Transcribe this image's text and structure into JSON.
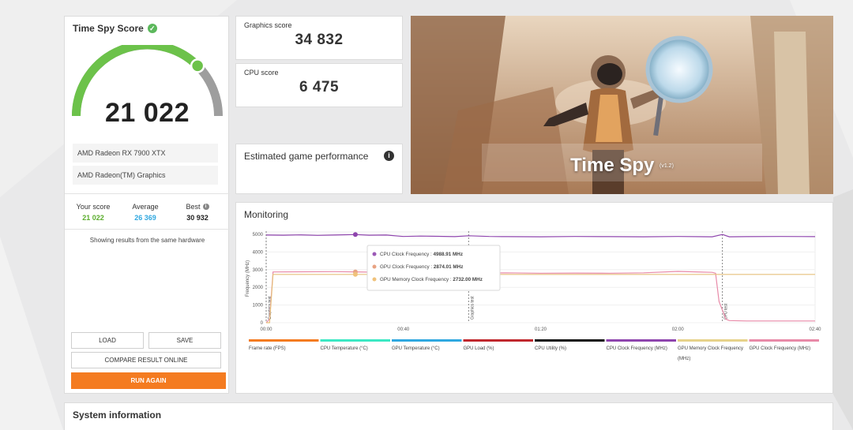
{
  "score_card": {
    "title": "Time Spy Score",
    "score": "21 022",
    "gauge_fraction": 0.75,
    "hardware": [
      "AMD Radeon RX 7900 XTX",
      "AMD Radeon(TM) Graphics"
    ],
    "your_score_label": "Your score",
    "your_score": "21 022",
    "average_label": "Average",
    "average": "26 369",
    "best_label": "Best",
    "best": "30 932",
    "same_hardware_note": "Showing results from the same hardware",
    "buttons": {
      "load": "LOAD",
      "save": "SAVE",
      "compare": "COMPARE RESULT ONLINE",
      "run_again": "RUN AGAIN"
    }
  },
  "graphics_score": {
    "label": "Graphics score",
    "value": "34 832"
  },
  "cpu_score": {
    "label": "CPU score",
    "value": "6 475"
  },
  "estimated_game_performance": {
    "title": "Estimated game performance"
  },
  "hero": {
    "title": "Time Spy",
    "version": "(v1.2)"
  },
  "monitoring": {
    "title": "Monitoring",
    "ylabel": "Frequency (MHz)",
    "tooltip": [
      {
        "label": "CPU Clock Frequency",
        "value": "4988.91 MHz",
        "color": "#9b59b6"
      },
      {
        "label": "GPU Clock Frequency",
        "value": "2874.01 MHz",
        "color": "#e8a383"
      },
      {
        "label": "GPU Memory Clock Frequency",
        "value": "2732.00 MHz",
        "color": "#f0c27b"
      }
    ],
    "legend": [
      {
        "label": "Frame rate (FPS)",
        "color": "#f47b20"
      },
      {
        "label": "CPU Temperature (°C)",
        "color": "#3be8c3"
      },
      {
        "label": "GPU Temperature (°C)",
        "color": "#2fa8e0"
      },
      {
        "label": "GPU Load (%)",
        "color": "#c0272d"
      },
      {
        "label": "CPU Utility (%)",
        "color": "#111111"
      },
      {
        "label": "CPU Clock Frequency (MHz)",
        "color": "#8e44ad"
      },
      {
        "label": "GPU Memory Clock Frequency (MHz)",
        "color": "#e6d28a"
      },
      {
        "label": "GPU Clock Frequency (MHz)",
        "color": "#e88aa8"
      }
    ],
    "markers": [
      "Graphics test",
      "Graphics test",
      "CPU test"
    ]
  },
  "chart_data": {
    "type": "line",
    "ylabel": "Frequency (MHz)",
    "ylim": [
      0,
      5000
    ],
    "yticks": [
      0,
      1000,
      2000,
      3000,
      4000,
      5000
    ],
    "xlim": [
      0,
      160
    ],
    "xticks": [
      0,
      40,
      80,
      120,
      160
    ],
    "xtick_labels": [
      "00:00",
      "00:40",
      "01:20",
      "02:00",
      "02:40"
    ],
    "marker_x": [
      0,
      59,
      133
    ],
    "series": [
      {
        "name": "CPU Clock Frequency (MHz)",
        "color": "#8e44ad",
        "x": [
          0,
          5,
          10,
          15,
          20,
          26,
          30,
          35,
          40,
          45,
          50,
          55,
          59,
          65,
          70,
          80,
          90,
          100,
          110,
          120,
          130,
          133,
          135,
          140,
          150,
          160
        ],
        "y": [
          4960,
          4950,
          4970,
          4940,
          4960,
          4988,
          4950,
          4960,
          4880,
          4900,
          4890,
          4870,
          4920,
          4880,
          4870,
          4860,
          4880,
          4870,
          4860,
          4880,
          4860,
          4990,
          4860,
          4870,
          4880,
          4870
        ]
      },
      {
        "name": "GPU Clock Frequency (MHz)",
        "color": "#e88aa8",
        "x": [
          0,
          1,
          2,
          10,
          20,
          26,
          30,
          40,
          50,
          59,
          60,
          70,
          80,
          90,
          100,
          110,
          120,
          130,
          131,
          132,
          133,
          134,
          135,
          140,
          150,
          160
        ],
        "y": [
          0,
          200,
          2870,
          2880,
          2890,
          2874,
          2860,
          2850,
          2860,
          2850,
          2800,
          2820,
          2800,
          2810,
          2800,
          2820,
          2900,
          2850,
          2800,
          1200,
          700,
          200,
          120,
          100,
          100,
          100
        ]
      },
      {
        "name": "GPU Memory Clock Frequency (MHz)",
        "color": "#e6c07b",
        "x": [
          0,
          1,
          2,
          20,
          40,
          60,
          80,
          100,
          120,
          140,
          160
        ],
        "y": [
          0,
          0,
          2732,
          2732,
          2732,
          2732,
          2732,
          2732,
          2732,
          2732,
          2732
        ]
      }
    ]
  }
}
